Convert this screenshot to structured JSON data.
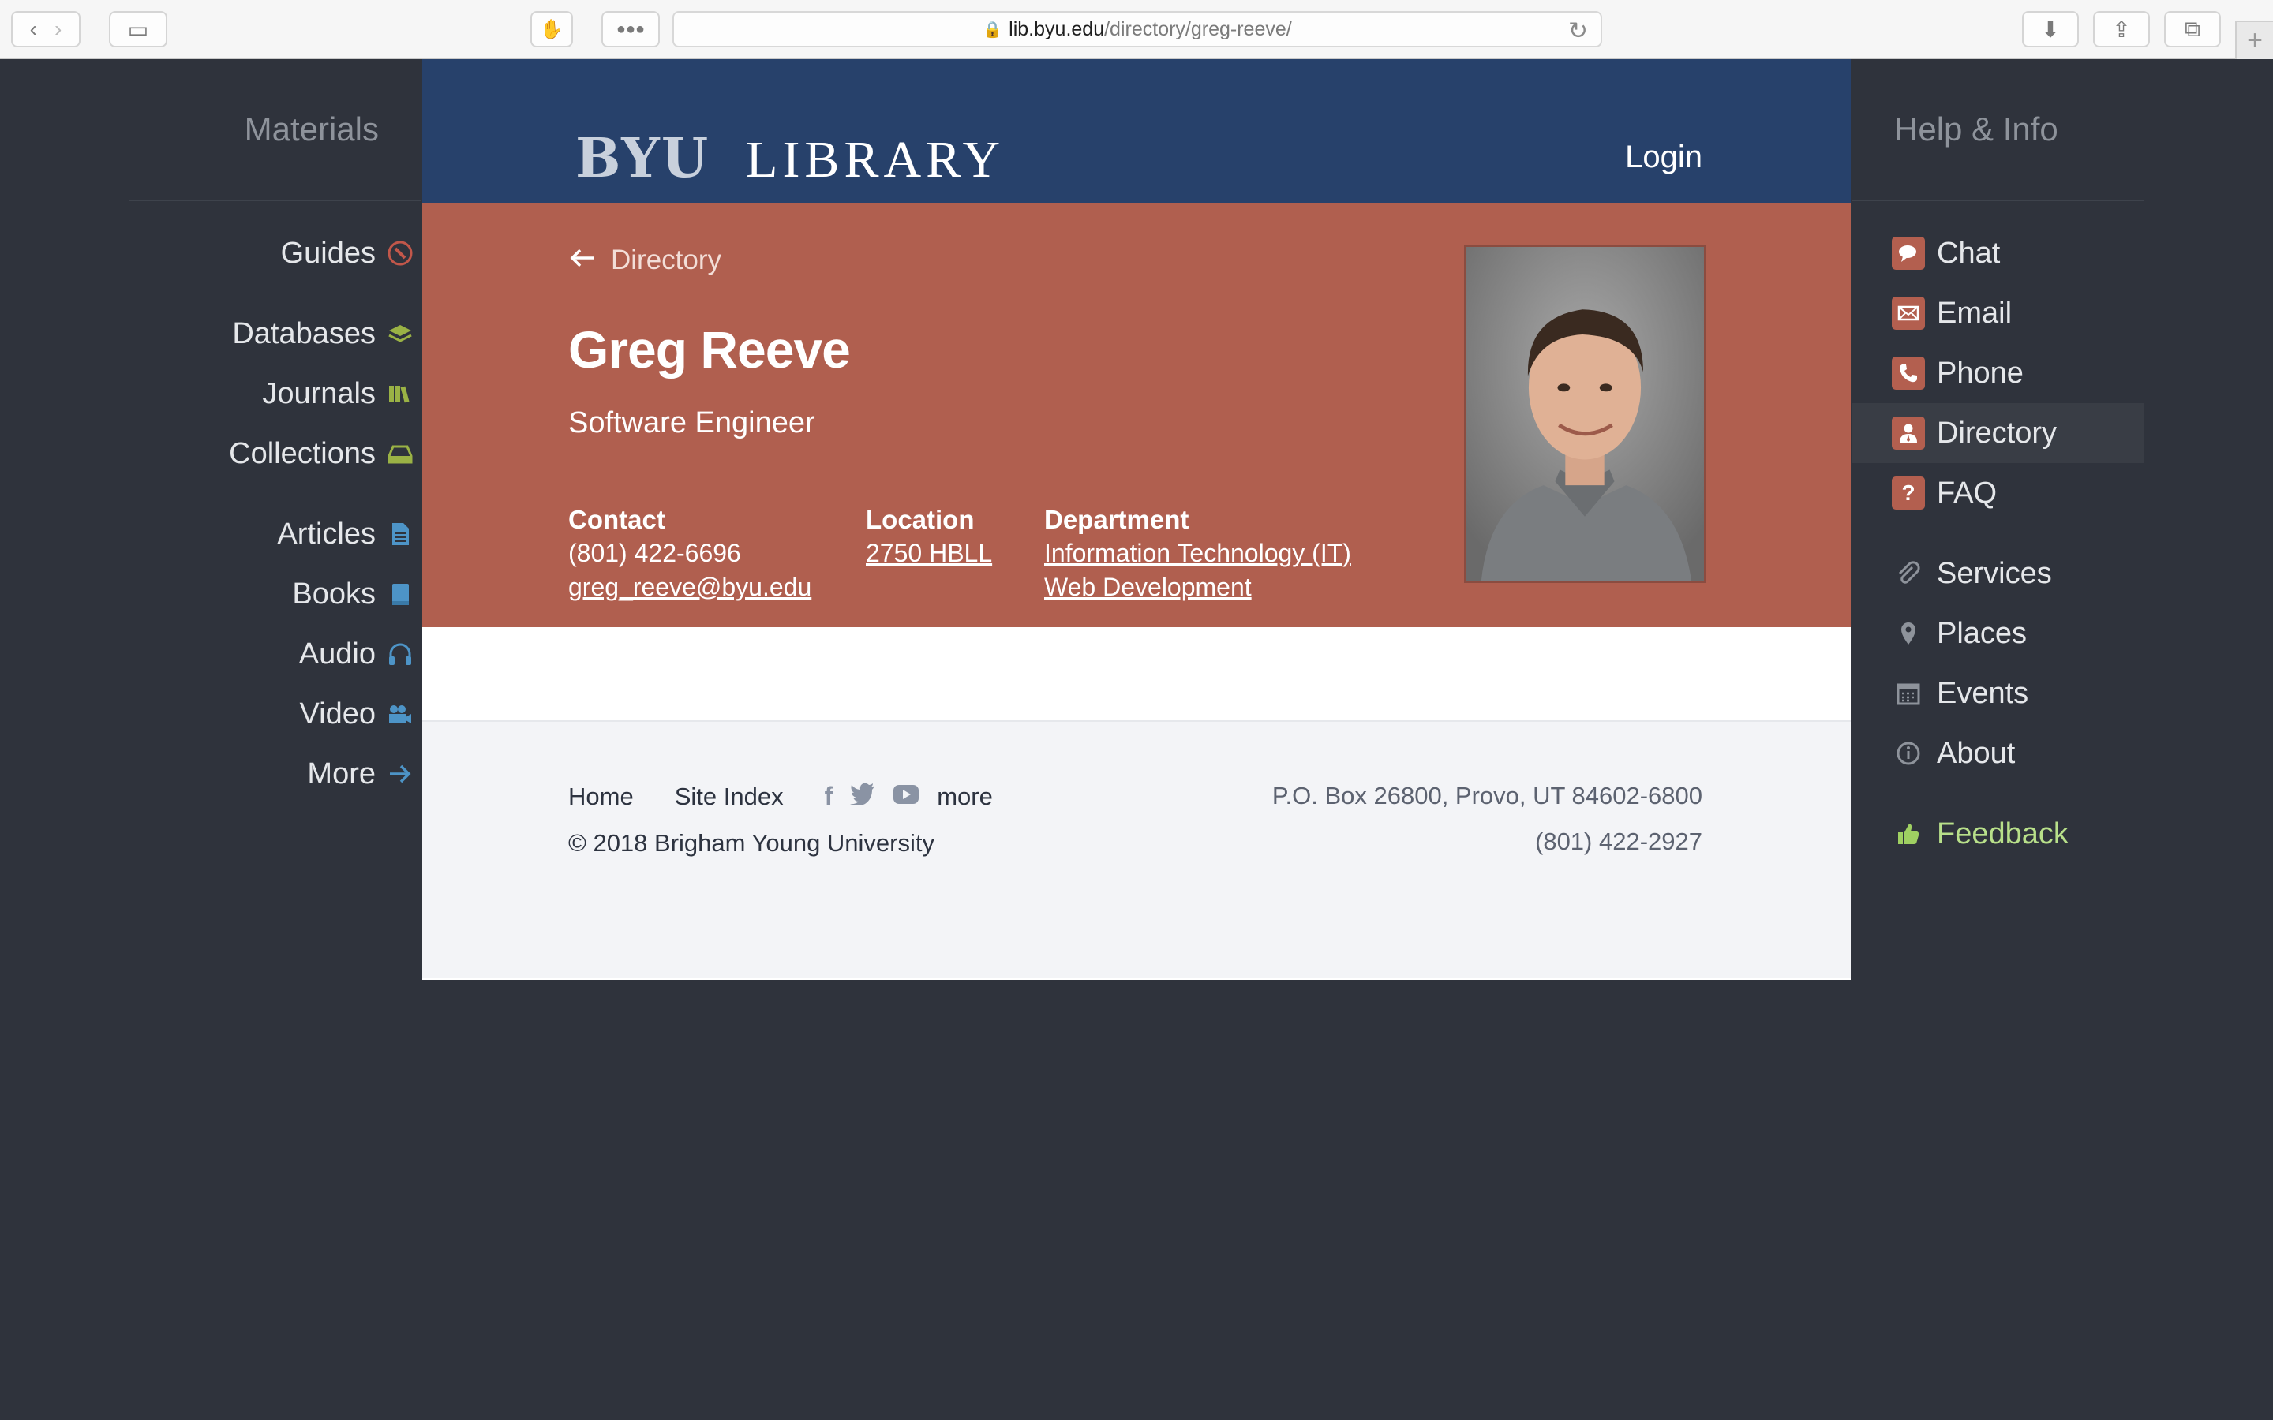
{
  "browser": {
    "url_host": "lib.byu.edu",
    "url_path": "/directory/greg-reeve/"
  },
  "site": {
    "logo_byu": "BYU",
    "logo_library": "LIBRARY",
    "login": "Login"
  },
  "left_nav": {
    "heading": "Materials",
    "items": [
      {
        "label": "Guides",
        "icon": "compass-icon",
        "color": "#c2574a"
      },
      {
        "label": "Databases",
        "icon": "layers-icon",
        "color": "#9ab245"
      },
      {
        "label": "Journals",
        "icon": "books-icon",
        "color": "#9ab245"
      },
      {
        "label": "Collections",
        "icon": "archive-icon",
        "color": "#9ab245"
      },
      {
        "label": "Articles",
        "icon": "document-icon",
        "color": "#4d94c7"
      },
      {
        "label": "Books",
        "icon": "book-icon",
        "color": "#4d94c7"
      },
      {
        "label": "Audio",
        "icon": "headphones-icon",
        "color": "#4d94c7"
      },
      {
        "label": "Video",
        "icon": "video-icon",
        "color": "#4d94c7"
      },
      {
        "label": "More",
        "icon": "arrow-right-icon",
        "color": "#4d94c7"
      }
    ]
  },
  "right_nav": {
    "heading": "Help & Info",
    "items": [
      {
        "label": "Chat",
        "icon": "chat-icon"
      },
      {
        "label": "Email",
        "icon": "mail-icon"
      },
      {
        "label": "Phone",
        "icon": "phone-icon"
      },
      {
        "label": "Directory",
        "icon": "person-icon"
      },
      {
        "label": "FAQ",
        "icon": "question-icon"
      },
      {
        "label": "Services",
        "icon": "paperclip-icon"
      },
      {
        "label": "Places",
        "icon": "map-pin-icon"
      },
      {
        "label": "Events",
        "icon": "calendar-icon"
      },
      {
        "label": "About",
        "icon": "info-icon"
      },
      {
        "label": "Feedback",
        "icon": "thumbs-up-icon",
        "color": "#b8e08a"
      }
    ]
  },
  "profile": {
    "breadcrumb": "Directory",
    "name": "Greg Reeve",
    "title": "Software Engineer",
    "contact_label": "Contact",
    "phone": "(801) 422-6696",
    "email": "greg_reeve@byu.edu",
    "location_label": "Location",
    "location": "2750 HBLL",
    "department_label": "Department",
    "department": "Information Technology (IT)",
    "subdepartment": "Web Development",
    "photo": "portrait-photo"
  },
  "footer": {
    "home": "Home",
    "site_index": "Site Index",
    "more": "more",
    "copyright": "© 2018 Brigham Young University",
    "address": "P.O. Box 26800, Provo, UT 84602-6800",
    "phone": "(801) 422-2927"
  },
  "colors": {
    "header": "#27416b",
    "profile_bg": "#b05f4f",
    "page_bg": "#2f333c"
  }
}
